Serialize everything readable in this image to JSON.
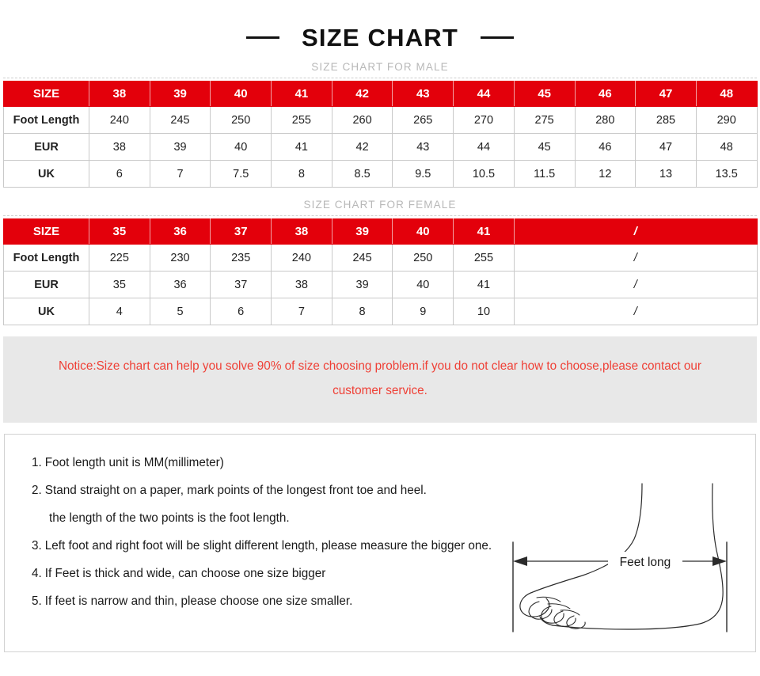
{
  "header": {
    "title": "SIZE CHART",
    "left_dash": "—",
    "right_dash": "—"
  },
  "male_section": {
    "caption": "SIZE CHART FOR MALE",
    "row_label_header": "SIZE",
    "sizes": [
      "38",
      "39",
      "40",
      "41",
      "42",
      "43",
      "44",
      "45",
      "46",
      "47",
      "48"
    ],
    "rows": [
      {
        "label": "Foot Length",
        "values": [
          "240",
          "245",
          "250",
          "255",
          "260",
          "265",
          "270",
          "275",
          "280",
          "285",
          "290"
        ]
      },
      {
        "label": "EUR",
        "values": [
          "38",
          "39",
          "40",
          "41",
          "42",
          "43",
          "44",
          "45",
          "46",
          "47",
          "48"
        ]
      },
      {
        "label": "UK",
        "values": [
          "6",
          "7",
          "7.5",
          "8",
          "8.5",
          "9.5",
          "10.5",
          "11.5",
          "12",
          "13",
          "13.5"
        ]
      }
    ]
  },
  "female_section": {
    "caption": "SIZE CHART FOR FEMALE",
    "row_label_header": "SIZE",
    "sizes": [
      "35",
      "36",
      "37",
      "38",
      "39",
      "40",
      "41"
    ],
    "empty_marker": "/",
    "rows": [
      {
        "label": "Foot Length",
        "values": [
          "225",
          "230",
          "235",
          "240",
          "245",
          "250",
          "255"
        ],
        "empty": "/"
      },
      {
        "label": "EUR",
        "values": [
          "35",
          "36",
          "37",
          "38",
          "39",
          "40",
          "41"
        ],
        "empty": "/"
      },
      {
        "label": "UK",
        "values": [
          "4",
          "5",
          "6",
          "7",
          "8",
          "9",
          "10"
        ],
        "empty": "/"
      }
    ]
  },
  "notice": {
    "line1": "Notice:Size chart can help you solve 90% of size choosing problem.if you do not clear how to choose,please contact our",
    "line2": "customer service."
  },
  "instructions": {
    "items": [
      {
        "num": "1.",
        "text": "Foot length unit is MM(millimeter)"
      },
      {
        "num": "2.",
        "text": "Stand straight on a paper, mark points of the longest front toe and heel."
      },
      {
        "num": "",
        "text": "the length of the two points is the foot length.",
        "continuation": true
      },
      {
        "num": "3.",
        "text": "Left foot and right foot will be slight different length, please measure the bigger one."
      },
      {
        "num": "4.",
        "text": "If Feet is thick and wide, can choose one size bigger"
      },
      {
        "num": "5.",
        "text": "If feet is narrow and thin, please choose one size smaller."
      }
    ]
  },
  "diagram": {
    "measure_label": "Feet long"
  },
  "colors": {
    "brand_red": "#e3000b",
    "notice_red": "#ef4036",
    "notice_bg": "#e8e8e8",
    "caption_gray": "#b8b8b8",
    "border_gray": "#c9c9c9"
  }
}
